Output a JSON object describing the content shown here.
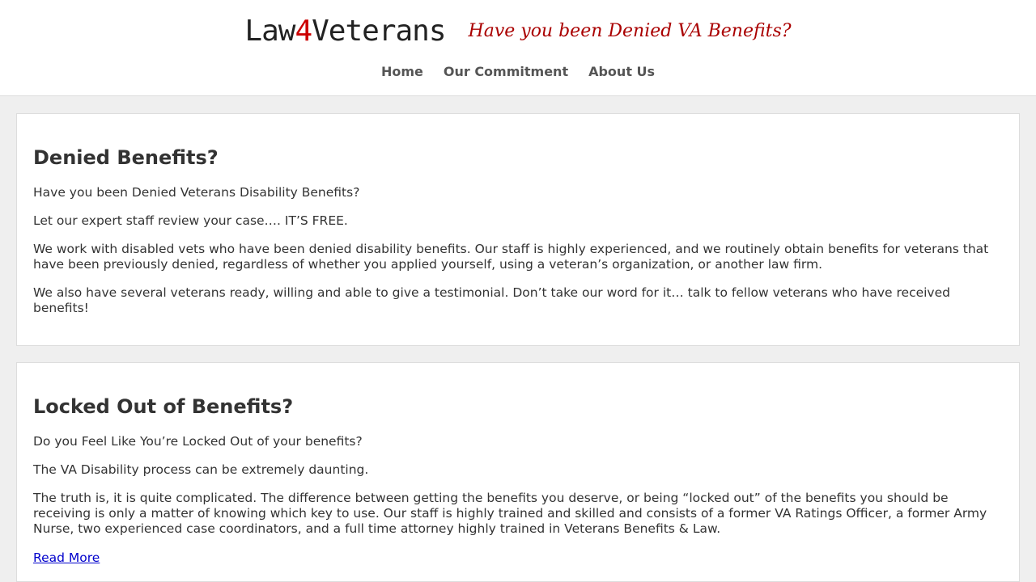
{
  "header": {
    "logo": {
      "part1": "Law",
      "part2": "4",
      "part3": "Veterans"
    },
    "tagline": "Have you been Denied VA Benefits?",
    "nav": [
      "Home",
      "Our Commitment",
      "About Us"
    ]
  },
  "cards": [
    {
      "title": "Denied Benefits?",
      "paragraphs": [
        "Have you been Denied Veterans Disability Benefits?",
        "Let our expert staff review your case…. IT’S FREE.",
        "We work with disabled vets who have been denied disability benefits. Our staff is highly experienced, and we routinely obtain benefits for veterans that have been previously denied, regardless of whether you applied yourself, using a veteran’s organization, or another law firm.",
        "We also have several veterans ready, willing and able to give a testimonial. Don’t take our word for it… talk to fellow veterans who have received benefits!"
      ]
    },
    {
      "title": "Locked Out of Benefits?",
      "paragraphs": [
        "Do you Feel Like You’re Locked Out of your benefits?",
        "The VA Disability process can be extremely daunting.",
        "The truth is, it is quite complicated. The difference between getting the benefits you deserve, or being “locked out” of the benefits you should be receiving is only a matter of knowing which key to use. Our staff is highly trained and skilled and consists of a former VA Ratings Officer, a former Army Nurse, two experienced case coordinators, and a full time attorney highly trained in Veterans Benefits & Law."
      ],
      "read_more": "Read More"
    }
  ],
  "colors": {
    "logo_accent": "#cc0000",
    "tagline": "#aa0000",
    "link": "#0000cc",
    "page_bg": "#efefef"
  }
}
